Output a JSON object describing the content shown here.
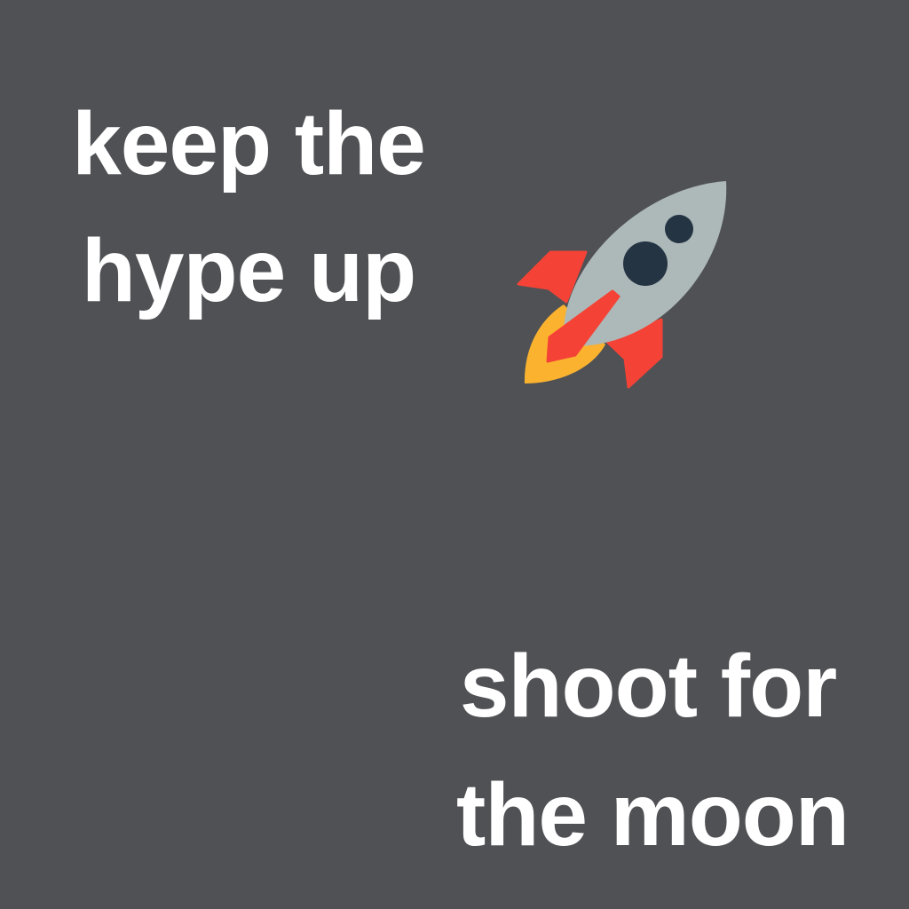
{
  "top_text": {
    "line1": "keep the",
    "line2": "hype up"
  },
  "bottom_text": {
    "line1": "shoot for",
    "line2": "the moon"
  },
  "icon": "rocket-icon",
  "colors": {
    "background": "#505155",
    "text": "#ffffff",
    "rocket_body": "#adb8b9",
    "rocket_fins": "#f44336",
    "rocket_flame": "#fbb32f",
    "rocket_windows": "#243443"
  }
}
